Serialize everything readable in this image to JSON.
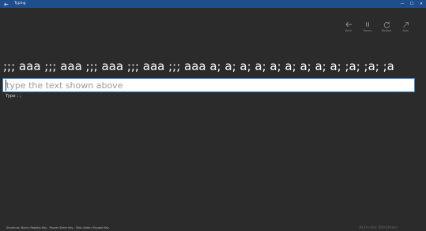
{
  "window": {
    "title": "Typing",
    "back_icon": "back-arrow-icon",
    "controls": {
      "minimize_glyph": "—",
      "maximize_glyph": "☐",
      "close_glyph": "✕"
    }
  },
  "appbar": {
    "items": [
      {
        "label": "Back",
        "icon": "back-arrow-icon"
      },
      {
        "label": "Pause",
        "icon": "pause-icon"
      },
      {
        "label": "Restart",
        "icon": "restart-icon"
      },
      {
        "label": "Skip",
        "icon": "skip-icon"
      }
    ]
  },
  "prompt_text": ";;; aaa ;;; aaa ;;; aaa ;;; aaa ;;; aaa a; a; a; a; a; a; a; a; a; ;a; ;a; ;a",
  "input": {
    "value": "",
    "placeholder": "type the text shown above"
  },
  "type_hint": "Type : ;",
  "shortcuts_text": "Shortcuts: Back=PageUp Key , Pause=Enter Key , Skip Letter=Escape Key",
  "watermark_text": "Activate Windows",
  "colors": {
    "background": "#2b2b2b",
    "titlebar": "#1f4e8c",
    "input_border": "#3b83d4"
  }
}
